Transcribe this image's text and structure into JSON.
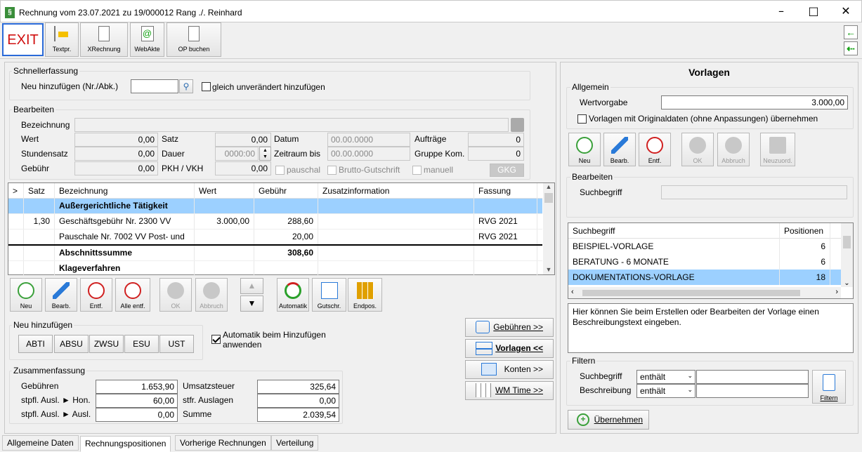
{
  "window": {
    "title": "Rechnung vom 23.07.2021 zu 19/000012  Rang ./. Reinhard",
    "app_icon": "§"
  },
  "toolbar": {
    "exit": "EXIT",
    "textpr": "Textpr.",
    "xrechnung": "XRechnung",
    "webakte": "WebAkte",
    "op_buchen": "OP buchen"
  },
  "schnell": {
    "title": "Schnellerfassung",
    "neu_label": "Neu hinzufügen (Nr./Abk.)",
    "neu_value": "",
    "unveraendert": "gleich unverändert hinzufügen"
  },
  "bearbeiten": {
    "title": "Bearbeiten",
    "bezeichnung_label": "Bezeichnung",
    "bezeichnung_value": "",
    "wert_label": "Wert",
    "wert": "0,00",
    "stundensatz_label": "Stundensatz",
    "stundensatz": "0,00",
    "gebuehr_label": "Gebühr",
    "gebuehr": "0,00",
    "satz_label": "Satz",
    "satz": "0,00",
    "dauer_label": "Dauer",
    "dauer": "0000:00",
    "pkh_label": "PKH / VKH",
    "pkh": "0,00",
    "datum_label": "Datum",
    "datum": "00.00.0000",
    "zeitraum_label": "Zeitraum bis",
    "zeitraum": "00.00.0000",
    "pauschal": "pauschal",
    "brutto": "Brutto-Gutschrift",
    "auftraege_label": "Aufträge",
    "auftraege": "0",
    "gruppe_label": "Gruppe Kom.",
    "gruppe": "0",
    "manuell": "manuell",
    "gkg": "GKG"
  },
  "table": {
    "headers": [
      ">",
      "Satz",
      "Bezeichnung",
      "Wert",
      "Gebühr",
      "Zusatzinformation",
      "Fassung"
    ],
    "rows": [
      {
        "satz": "",
        "bez": "Außergerichtliche Tätigkeit",
        "wert": "",
        "gebuehr": "",
        "zusatz": "",
        "fassung": ""
      },
      {
        "satz": "1,30",
        "bez": "Geschäftsgebühr Nr. 2300 VV",
        "wert": "3.000,00",
        "gebuehr": "288,60",
        "zusatz": "",
        "fassung": "RVG 2021"
      },
      {
        "satz": "",
        "bez": "Pauschale Nr. 7002 VV Post- und",
        "wert": "",
        "gebuehr": "20,00",
        "zusatz": "",
        "fassung": "RVG 2021"
      },
      {
        "satz": "",
        "bez": "Abschnittssumme",
        "wert": "",
        "gebuehr": "308,60",
        "zusatz": "",
        "fassung": ""
      },
      {
        "satz": "",
        "bez": "Klageverfahren",
        "wert": "",
        "gebuehr": "",
        "zusatz": "",
        "fassung": ""
      }
    ]
  },
  "tablebuttons": {
    "neu": "Neu",
    "bearb": "Bearb.",
    "entf": "Entf.",
    "alle_entf": "Alle entf.",
    "ok": "OK",
    "abbruch": "Abbruch",
    "automatik": "Automatik",
    "gutschr": "Gutschr.",
    "endpos": "Endpos."
  },
  "neu_hinzufuegen": {
    "title": "Neu hinzufügen",
    "buttons": [
      "ABTI",
      "ABSU",
      "ZWSU",
      "ESU",
      "UST"
    ],
    "automatik": "Automatik beim Hinzufügen anwenden"
  },
  "nav": {
    "gebuehren": "Gebühren >>",
    "vorlagen": "Vorlagen <<",
    "konten": "Konten >>",
    "wmtime": "WM Time >>"
  },
  "zusammenfassung": {
    "title": "Zusammenfassung",
    "gebuehren_label": "Gebühren",
    "gebuehren": "1.653,90",
    "hon_label": "stpfl. Ausl. ► Hon.",
    "hon": "60,00",
    "ausl_label": "stpfl. Ausl. ► Ausl.",
    "ausl": "0,00",
    "ust_label": "Umsatzsteuer",
    "ust": "325,64",
    "stfr_label": "stfr. Auslagen",
    "stfr": "0,00",
    "summe_label": "Summe",
    "summe": "2.039,54"
  },
  "tabs": [
    "Allgemeine Daten",
    "Rechnungspositionen",
    "Vorherige Rechnungen",
    "Verteilung"
  ],
  "vorlagen": {
    "title": "Vorlagen",
    "allgemein": "Allgemein",
    "wertvorgabe_label": "Wertvorgabe",
    "wertvorgabe": "3.000,00",
    "original": "Vorlagen mit Originaldaten (ohne Anpassungen) übernehmen",
    "buttons": {
      "neu": "Neu",
      "bearb": "Bearb.",
      "entf": "Entf.",
      "ok": "OK",
      "abbruch": "Abbruch",
      "neuzuord": "Neuzuord."
    },
    "bearbeiten": "Bearbeiten",
    "suchbegriff_label": "Suchbegriff",
    "suchbegriff": "",
    "list_headers": [
      "Suchbegriff",
      "Positionen"
    ],
    "list": [
      {
        "name": "BEISPIEL-VORLAGE",
        "pos": "6"
      },
      {
        "name": "BERATUNG - 6 MONATE",
        "pos": "6"
      },
      {
        "name": "DOKUMENTATIONS-VORLAGE",
        "pos": "18"
      }
    ],
    "beschreibung": "Hier können Sie beim Erstellen oder Bearbeiten der Vorlage einen Beschreibungstext eingeben.",
    "filtern": "Filtern",
    "filter_such_label": "Suchbegriff",
    "filter_such_op": "enthält",
    "filter_besch_label": "Beschreibung",
    "filter_besch_op": "enthält",
    "filtern_btn": "Filtern",
    "uebernehmen": "Übernehmen"
  },
  "colors": {
    "selection": "#9cd0ff",
    "exit_red": "#d01010",
    "green": "#12a012"
  }
}
